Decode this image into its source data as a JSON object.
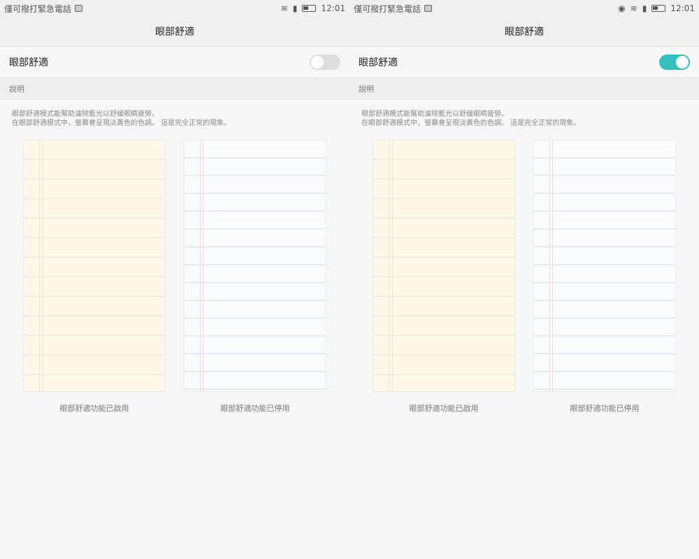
{
  "status": {
    "carrier": "僅可撥打緊急電話",
    "time": "12:01"
  },
  "header": {
    "title": "眼部舒適"
  },
  "setting": {
    "label": "眼部舒適"
  },
  "section": {
    "label": "說明"
  },
  "description": {
    "line1": "眼部舒適模式能幫助濾除藍光以舒緩眼睛疲勞。",
    "line2": "在眼部舒適模式中，螢幕會呈現淡黃色的色調。 這是完全正常的現象。"
  },
  "captions": {
    "enabled": "眼部舒適功能已啟用",
    "disabled": "眼部舒適功能已停用"
  },
  "panels": [
    {
      "toggle_on": false
    },
    {
      "toggle_on": true
    }
  ],
  "colors": {
    "accent": "#36bfc1"
  }
}
